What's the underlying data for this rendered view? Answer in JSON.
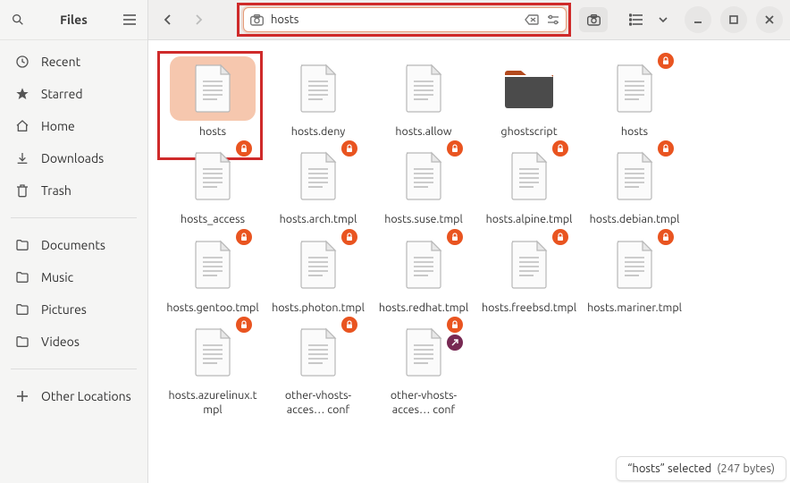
{
  "sidebar": {
    "title": "Files",
    "items": [
      {
        "label": "Recent",
        "icon": "clock"
      },
      {
        "label": "Starred",
        "icon": "star"
      },
      {
        "label": "Home",
        "icon": "home"
      },
      {
        "label": "Downloads",
        "icon": "download"
      },
      {
        "label": "Trash",
        "icon": "trash"
      }
    ],
    "places": [
      {
        "label": "Documents",
        "icon": "folder"
      },
      {
        "label": "Music",
        "icon": "folder"
      },
      {
        "label": "Pictures",
        "icon": "folder"
      },
      {
        "label": "Videos",
        "icon": "folder"
      }
    ],
    "other": {
      "label": "Other Locations",
      "icon": "plus"
    }
  },
  "toolbar": {
    "search_value": "hosts"
  },
  "files": [
    {
      "label": "hosts",
      "type": "text",
      "selected": true
    },
    {
      "label": "hosts.deny",
      "type": "text"
    },
    {
      "label": "hosts.allow",
      "type": "text"
    },
    {
      "label": "ghostscript",
      "type": "folder"
    },
    {
      "label": "hosts",
      "type": "text",
      "lock": true
    },
    {
      "label": "hosts_access",
      "type": "text",
      "lock": true
    },
    {
      "label": "hosts.arch.tmpl",
      "type": "text",
      "lock": true
    },
    {
      "label": "hosts.suse.tmpl",
      "type": "text",
      "lock": true
    },
    {
      "label": "hosts.alpine.tmpl",
      "type": "text",
      "lock": true
    },
    {
      "label": "hosts.debian.tmpl",
      "type": "text",
      "lock": true
    },
    {
      "label": "hosts.gentoo.tmpl",
      "type": "text",
      "lock": true
    },
    {
      "label": "hosts.photon.tmpl",
      "type": "text",
      "lock": true
    },
    {
      "label": "hosts.redhat.tmpl",
      "type": "text",
      "lock": true
    },
    {
      "label": "hosts.freebsd.tmpl",
      "type": "text",
      "lock": true
    },
    {
      "label": "hosts.mariner.tmpl",
      "type": "text",
      "lock": true
    },
    {
      "label": "hosts.azurelinux.tmpl",
      "type": "text",
      "lock": true
    },
    {
      "label": "other-vhosts-acces… conf",
      "type": "text",
      "lock": true
    },
    {
      "label": "other-vhosts-acces… conf",
      "type": "text",
      "lock": true,
      "link": true
    }
  ],
  "status": {
    "name": "“hosts” selected",
    "size": "(247 bytes)"
  }
}
